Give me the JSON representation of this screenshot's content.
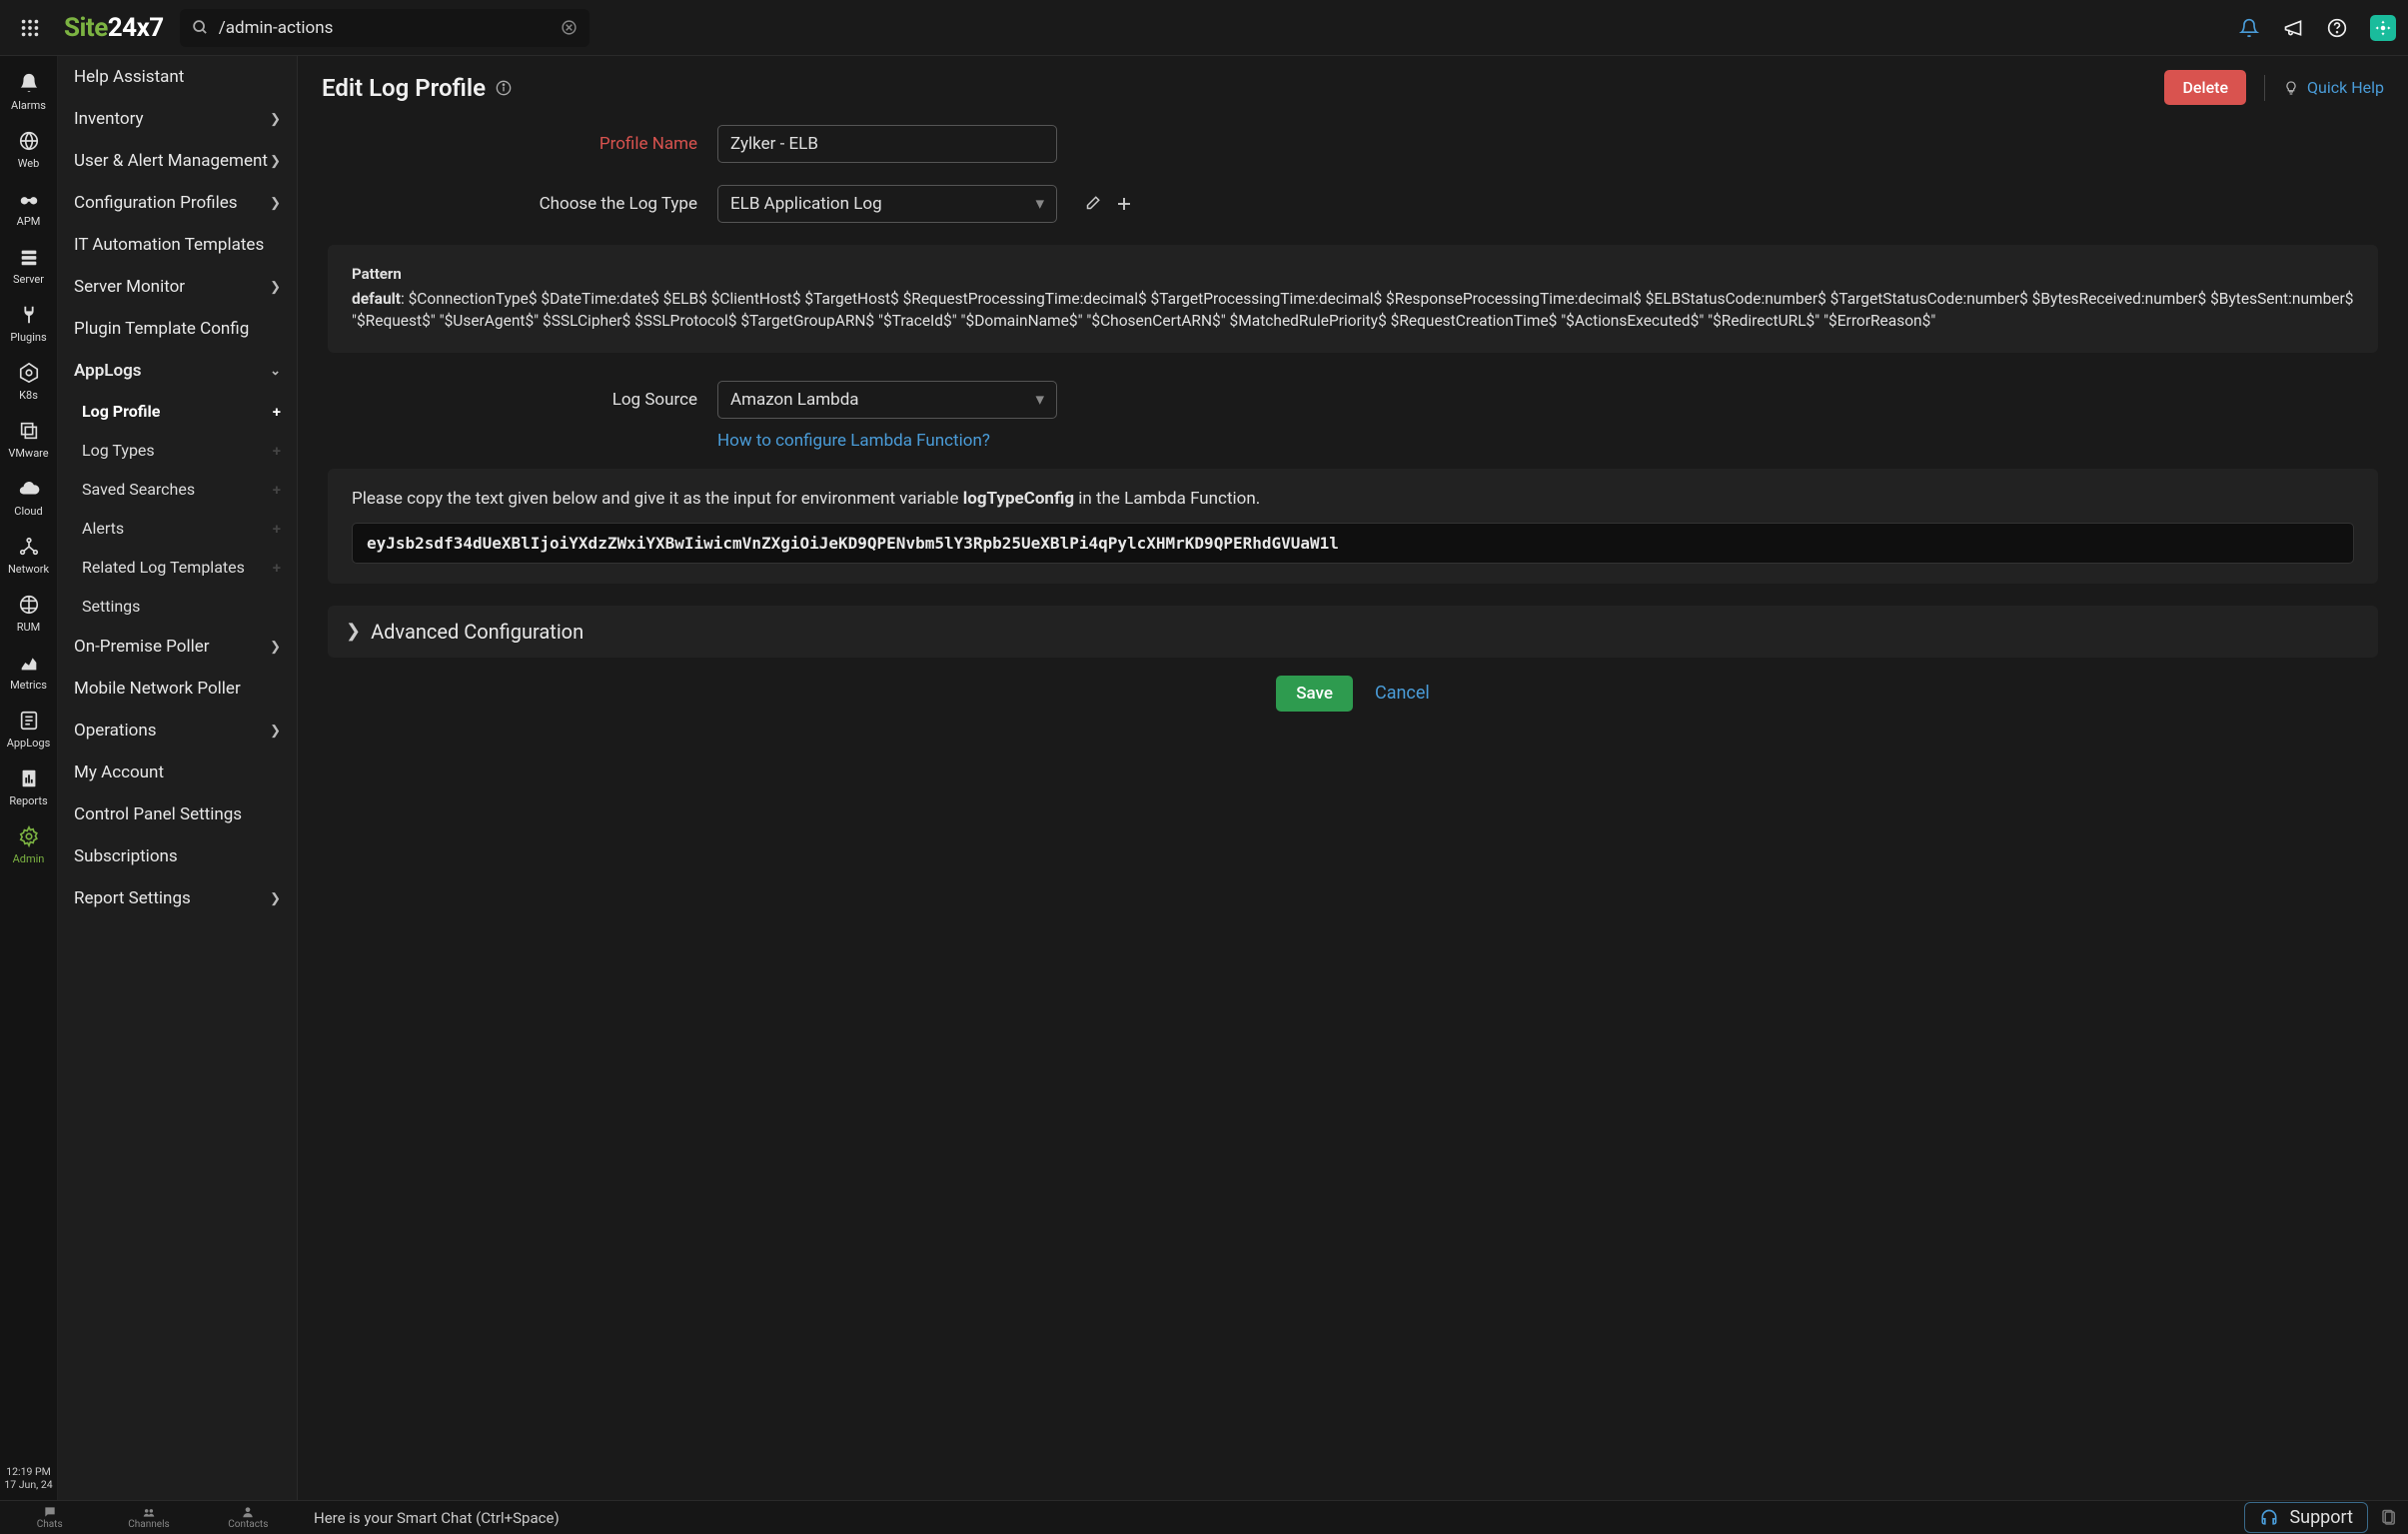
{
  "brand": {
    "part1": "Site",
    "part2": "24x7"
  },
  "search": {
    "value": "/admin-actions"
  },
  "leftrail": {
    "items": [
      {
        "label": "Alarms"
      },
      {
        "label": "Web"
      },
      {
        "label": "APM"
      },
      {
        "label": "Server"
      },
      {
        "label": "Plugins"
      },
      {
        "label": "K8s"
      },
      {
        "label": "VMware"
      },
      {
        "label": "Cloud"
      },
      {
        "label": "Network"
      },
      {
        "label": "RUM"
      },
      {
        "label": "Metrics"
      },
      {
        "label": "AppLogs"
      },
      {
        "label": "Reports"
      },
      {
        "label": "Admin"
      }
    ],
    "time": "12:19 PM",
    "date": "17 Jun, 24"
  },
  "sidebar": {
    "items": [
      {
        "label": "Help Assistant"
      },
      {
        "label": "Inventory",
        "chevron": true
      },
      {
        "label": "User & Alert Management",
        "chevron": true
      },
      {
        "label": "Configuration Profiles",
        "chevron": true
      },
      {
        "label": "IT Automation Templates"
      },
      {
        "label": "Server Monitor",
        "chevron": true
      },
      {
        "label": "Plugin Template Config"
      },
      {
        "label": "AppLogs",
        "chevron": true,
        "expanded": true
      },
      {
        "label": "On-Premise Poller",
        "chevron": true
      },
      {
        "label": "Mobile Network Poller"
      },
      {
        "label": "Operations",
        "chevron": true
      },
      {
        "label": "My Account"
      },
      {
        "label": "Control Panel Settings"
      },
      {
        "label": "Subscriptions"
      },
      {
        "label": "Report Settings",
        "chevron": true
      }
    ],
    "subitems": [
      {
        "label": "Log Profile",
        "active": true
      },
      {
        "label": "Log Types"
      },
      {
        "label": "Saved Searches"
      },
      {
        "label": "Alerts"
      },
      {
        "label": "Related Log Templates"
      },
      {
        "label": "Settings",
        "noplus": true
      }
    ]
  },
  "page": {
    "title": "Edit Log Profile",
    "deleteLabel": "Delete",
    "quickHelp": "Quick Help"
  },
  "form": {
    "profileNameLabel": "Profile Name",
    "profileNameValue": "Zylker - ELB",
    "logTypeLabel": "Choose the Log Type",
    "logTypeValue": "ELB Application Log",
    "logSourceLabel": "Log Source",
    "logSourceValue": "Amazon Lambda",
    "lambdaHelpLink": "How to configure Lambda Function?",
    "advancedLabel": "Advanced Configuration",
    "saveLabel": "Save",
    "cancelLabel": "Cancel"
  },
  "pattern": {
    "title": "Pattern",
    "prefix": "default",
    "text": ": $ConnectionType$ $DateTime:date$ $ELB$ $ClientHost$ $TargetHost$ $RequestProcessingTime:decimal$ $TargetProcessingTime:decimal$ $ResponseProcessingTime:decimal$ $ELBStatusCode:number$ $TargetStatusCode:number$ $BytesReceived:number$ $BytesSent:number$ \"$Request$\" \"$UserAgent$\" $SSLCipher$ $SSLProtocol$ $TargetGroupARN$ \"$TraceId$\" \"$DomainName$\" \"$ChosenCertARN$\" $MatchedRulePriority$ $RequestCreationTime$ \"$ActionsExecuted$\" \"$RedirectURL$\" \"$ErrorReason$\""
  },
  "copy": {
    "instructionPre": "Please copy the text given below and give it as the input for environment variable ",
    "instructionVar": "logTypeConfig",
    "instructionPost": " in the Lambda Function.",
    "token": "eyJsb2sdf34dUeXBlIjoiYXdzZWxiYXBwIiwicmVnZXgiOiJeKD9QPENvbm5lY3Rpb25UeXBlPi4qPylcXHMrKD9QPERhdGVUaW1l"
  },
  "bottombar": {
    "tabs": [
      {
        "label": "Chats"
      },
      {
        "label": "Channels"
      },
      {
        "label": "Contacts"
      }
    ],
    "smart": "Here is your Smart Chat  (Ctrl+Space)",
    "support": "Support"
  }
}
